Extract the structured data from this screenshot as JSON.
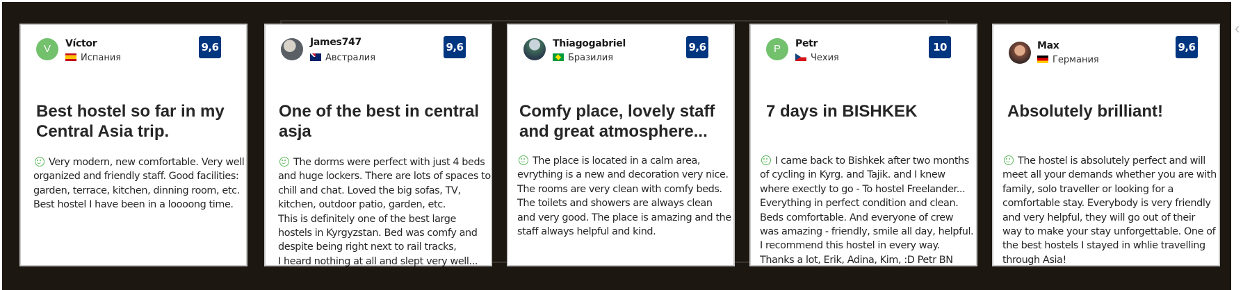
{
  "reviews": [
    {
      "name": "Víctor",
      "avatar_initial": "V",
      "avatar_type": "initial",
      "country": "Испания",
      "flag": "es",
      "score": "9,6",
      "title": "Best hostel so far in my Central Asia trip.",
      "text": "Very modern, new comfortable. Very well organized and friendly staff. Good facilities: garden, terrace, kitchen, dinning room, etc.\nBest hostel I have been in a loooong time."
    },
    {
      "name": "James747",
      "avatar_initial": "",
      "avatar_type": "photo",
      "country": "Австралия",
      "flag": "au",
      "score": "9,6",
      "title": "One of the best in central asja",
      "text": "The dorms were perfect with just 4 beds and huge lockers. There are lots of spaces to chill and chat. Loved the big sofas, TV, kitchen, outdoor patio, garden, etc.\nThis is definitely one of the best large hostels in Kyrgyzstan. Bed was comfy and despite being right next to rail tracks,\nI heard nothing at all and slept very well..."
    },
    {
      "name": "Thiagogabriel",
      "avatar_initial": "",
      "avatar_type": "photo",
      "country": "Бразилия",
      "flag": "br",
      "score": "9,6",
      "title": "Comfy place, lovely staff and great atmosphere...",
      "text": "The place is located in a calm area, evrything is a new and decoration very nice. The rooms are very clean with comfy beds. The toilets and showers are always clean and very good. The place is amazing and the staff always helpful and kind."
    },
    {
      "name": "Petr",
      "avatar_initial": "P",
      "avatar_type": "initial",
      "country": "Чехия",
      "flag": "cz",
      "score": "10",
      "title": "7 days in BISHKEK",
      "text": "I came back to Bishkek after two months of cycling in Kyrg. and Tajik. and I knew where exectly to go - To hostel Freelander...\nEverything in perfect condition and clean. Beds comfortable. And everyone of crew was amazing - friendly, smile all day, helpful.\nI recommend this hostel in every way.\nThanks a lot, Erik, Adina, Kim, :D Petr BN"
    },
    {
      "name": "Max",
      "avatar_initial": "",
      "avatar_type": "photo",
      "country": "Германия",
      "flag": "de",
      "score": "9,6",
      "title": "Absolutely brilliant!",
      "text": "The hostel is absolutely perfect and will meet all your demands whether you are with family, solo traveller or looking for a comfortable stay. Everybody is very friendly and very helpful, they will go out of their way to make your stay unforgettable. One of the best hostels I stayed in whlie travelling through Asia!"
    }
  ],
  "colors": {
    "background": "#1c1710",
    "score_badge": "#003580",
    "positive_icon": "#5cb85c",
    "avatar_initial_bg": "#73c16d"
  },
  "icons": {
    "positive": "smile-icon"
  }
}
